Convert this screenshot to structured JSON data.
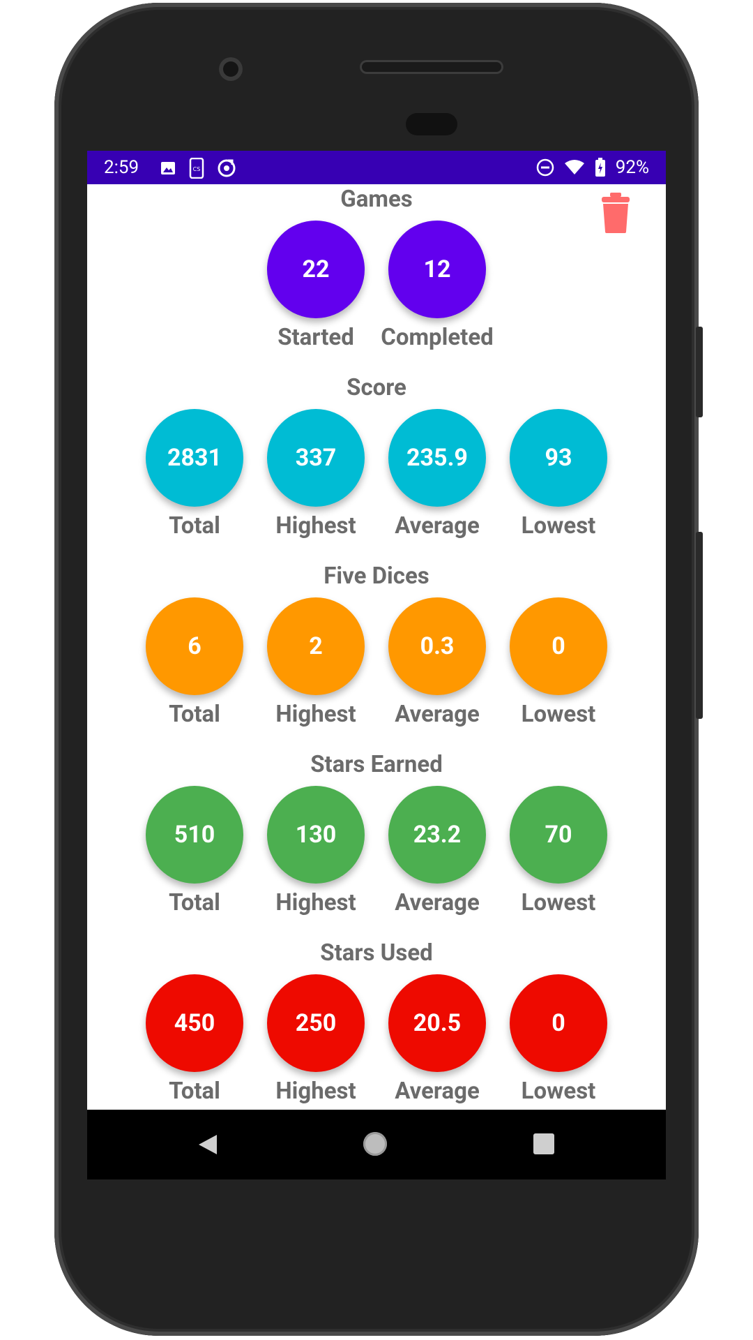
{
  "status_bar": {
    "time": "2:59",
    "battery": "92%",
    "left_icons": [
      "image-icon",
      "cast-icon",
      "sync-icon"
    ],
    "right_icons": [
      "do-not-disturb-icon",
      "wifi-icon",
      "battery-charging-icon"
    ]
  },
  "colors": {
    "status_bar": "#3700b3",
    "games": "#6200ee",
    "score": "#00bcd4",
    "five_dices": "#ff9800",
    "stars_earned": "#4caf50",
    "stars_used": "#ee0a00",
    "trash": "#ff6b6b"
  },
  "header": {
    "delete_icon": "trash-icon"
  },
  "sections": [
    {
      "title": "Games",
      "items": [
        {
          "value": "22",
          "label": "Started"
        },
        {
          "value": "12",
          "label": "Completed"
        }
      ]
    },
    {
      "title": "Score",
      "items": [
        {
          "value": "2831",
          "label": "Total"
        },
        {
          "value": "337",
          "label": "Highest"
        },
        {
          "value": "235.9",
          "label": "Average"
        },
        {
          "value": "93",
          "label": "Lowest"
        }
      ]
    },
    {
      "title": "Five Dices",
      "items": [
        {
          "value": "6",
          "label": "Total"
        },
        {
          "value": "2",
          "label": "Highest"
        },
        {
          "value": "0.3",
          "label": "Average"
        },
        {
          "value": "0",
          "label": "Lowest"
        }
      ]
    },
    {
      "title": "Stars Earned",
      "items": [
        {
          "value": "510",
          "label": "Total"
        },
        {
          "value": "130",
          "label": "Highest"
        },
        {
          "value": "23.2",
          "label": "Average"
        },
        {
          "value": "70",
          "label": "Lowest"
        }
      ]
    },
    {
      "title": "Stars Used",
      "items": [
        {
          "value": "450",
          "label": "Total"
        },
        {
          "value": "250",
          "label": "Highest"
        },
        {
          "value": "20.5",
          "label": "Average"
        },
        {
          "value": "0",
          "label": "Lowest"
        }
      ]
    }
  ],
  "nav_bar": {
    "buttons": [
      "back-icon",
      "home-icon",
      "recents-icon"
    ]
  }
}
